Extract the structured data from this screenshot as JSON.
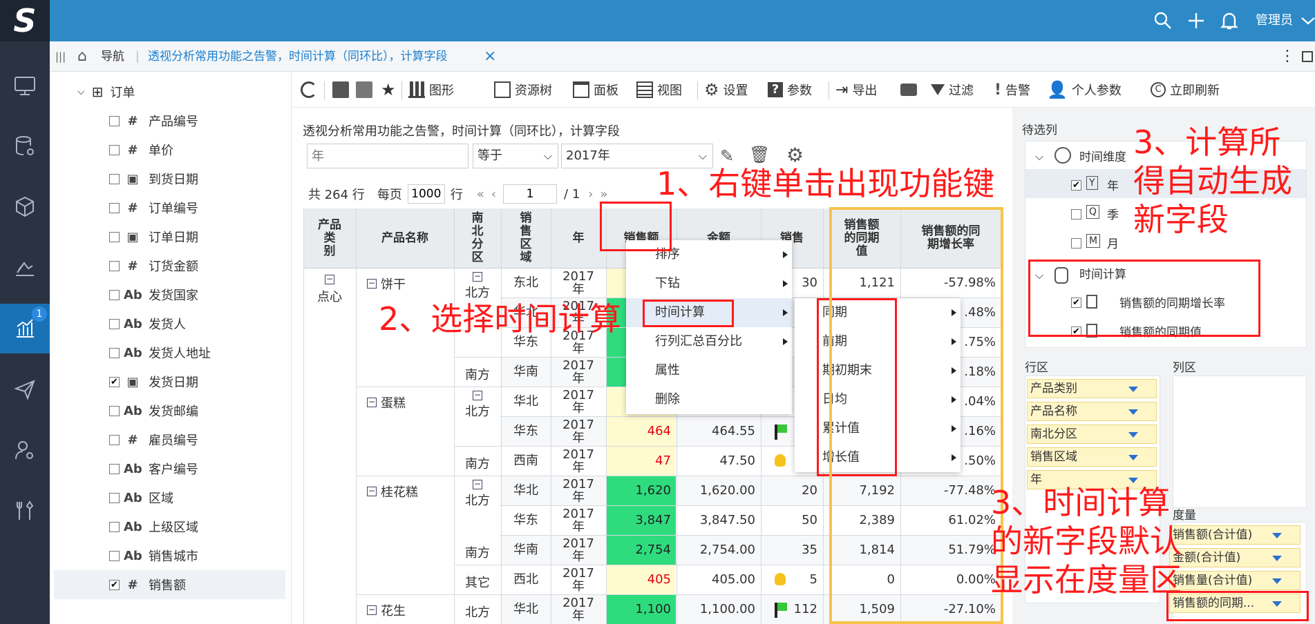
{
  "app": {
    "logo": "S",
    "user": "管理员",
    "nav_badge": "1"
  },
  "tab": {
    "nav_label": "导航",
    "title": "透视分析常用功能之告警，时间计算（同环比），计算字段",
    "close": "×"
  },
  "tree": {
    "root": "订单",
    "fields": [
      {
        "label": "产品编号",
        "type": "#",
        "checked": false
      },
      {
        "label": "单价",
        "type": "#",
        "checked": false
      },
      {
        "label": "到货日期",
        "type": "date",
        "checked": false
      },
      {
        "label": "订单编号",
        "type": "#",
        "checked": false
      },
      {
        "label": "订单日期",
        "type": "date",
        "checked": false
      },
      {
        "label": "订货金额",
        "type": "#",
        "checked": false
      },
      {
        "label": "发货国家",
        "type": "Ab",
        "checked": false
      },
      {
        "label": "发货人",
        "type": "Ab",
        "checked": false
      },
      {
        "label": "发货人地址",
        "type": "Ab",
        "checked": false
      },
      {
        "label": "发货日期",
        "type": "date",
        "checked": true
      },
      {
        "label": "发货邮编",
        "type": "Ab",
        "checked": false
      },
      {
        "label": "雇员编号",
        "type": "#",
        "checked": false
      },
      {
        "label": "客户编号",
        "type": "Ab",
        "checked": false
      },
      {
        "label": "区域",
        "type": "Ab",
        "checked": false
      },
      {
        "label": "上级区域",
        "type": "Ab",
        "checked": false
      },
      {
        "label": "销售城市",
        "type": "Ab",
        "checked": false
      },
      {
        "label": "销售额",
        "type": "#",
        "checked": true
      }
    ]
  },
  "toolbar": {
    "chart": "图形",
    "resource_tree": "资源树",
    "panel": "面板",
    "view": "视图",
    "settings": "设置",
    "params": "参数",
    "export": "导出",
    "filter": "过滤",
    "alert": "告警",
    "personal_params": "个人参数",
    "refresh": "立即刷新"
  },
  "report": {
    "title": "透视分析常用功能之告警，时间计算（同环比），计算字段"
  },
  "filter": {
    "field_placeholder": "年",
    "operator": "等于",
    "value": "2017年"
  },
  "pager": {
    "total": "共 264 行",
    "per_page_label": "每页",
    "per_page": "1000",
    "rows_label": "行",
    "page": "1",
    "total_pages": "/ 1"
  },
  "grid": {
    "headers": [
      "产品类别",
      "产品名称",
      "南北分区",
      "销售区域",
      "年",
      "销售额",
      "金额",
      "销售",
      "销售额的同期值",
      "销售额的同期增长率"
    ],
    "rows": [
      {
        "region": "东北",
        "year": "2017年",
        "sales": "",
        "amount": "",
        "qty": "30",
        "prev": "1,121",
        "growth": "-57.98%"
      },
      {
        "region": "华北",
        "year": "2017年",
        "sales": "",
        "amount": "",
        "qty": "",
        "prev": "",
        "growth": ".48%"
      },
      {
        "region": "华东",
        "year": "2017年",
        "sales": "",
        "amount": "",
        "qty": "",
        "prev": "",
        "growth": ".75%"
      },
      {
        "region": "华南",
        "year": "2017年",
        "sales": "",
        "amount": "",
        "qty": "",
        "prev": "",
        "growth": ".18%"
      },
      {
        "region": "华北",
        "year": "2017年",
        "sales": "",
        "amount": "",
        "qty": "",
        "prev": "",
        "growth": ".04%"
      },
      {
        "region": "华东",
        "year": "2017年",
        "sales": "464",
        "amount": "464.55",
        "qty": "",
        "prev": "",
        "growth": ".16%"
      },
      {
        "region": "西南",
        "year": "2017年",
        "sales": "47",
        "amount": "47.50",
        "qty": "",
        "prev": "",
        "growth": ".50%"
      },
      {
        "region": "华北",
        "year": "2017年",
        "sales": "1,620",
        "amount": "1,620.00",
        "qty": "20",
        "prev": "7,192",
        "growth": "-77.48%"
      },
      {
        "region": "华东",
        "year": "2017年",
        "sales": "3,847",
        "amount": "3,847.50",
        "qty": "50",
        "prev": "2,389",
        "growth": "61.02%"
      },
      {
        "region": "华南",
        "year": "2017年",
        "sales": "2,754",
        "amount": "2,754.00",
        "qty": "35",
        "prev": "1,814",
        "growth": "51.79%"
      },
      {
        "region": "西北",
        "year": "2017年",
        "sales": "405",
        "amount": "405.00",
        "qty": "5",
        "prev": "0",
        "growth": "0.00%"
      },
      {
        "region": "华北",
        "year": "2017年",
        "sales": "1,100",
        "amount": "1,100.00",
        "qty": "112",
        "prev": "1,509",
        "growth": "-27.10%"
      }
    ],
    "categories": [
      {
        "label": "点心"
      }
    ],
    "products": [
      {
        "label": "饼干"
      },
      {
        "label": "蛋糕"
      },
      {
        "label": "桂花糕"
      },
      {
        "label": "花生"
      }
    ],
    "zones": [
      {
        "label": "北方"
      },
      {
        "label": "南方"
      },
      {
        "label": "北方"
      },
      {
        "label": "南方"
      },
      {
        "label": "北方"
      },
      {
        "label": "南方"
      },
      {
        "label": "其它"
      },
      {
        "label": "北方"
      }
    ]
  },
  "context_menu": {
    "items": [
      "排序",
      "下钻",
      "时间计算",
      "行列汇总百分比",
      "属性",
      "删除"
    ],
    "submenu": [
      "同期",
      "前期",
      "期初期末",
      "日均",
      "累计值",
      "增长值"
    ]
  },
  "right_panel": {
    "pending": "待选列",
    "time_dim": "时间维度",
    "year": "年",
    "quarter": "季",
    "month": "月",
    "time_calc": "时间计算",
    "calc_growth": "销售额的同期增长率",
    "calc_prev": "销售额的同期值",
    "row_area": "行区",
    "col_area": "列区",
    "measure_area": "度量",
    "row_fields": [
      "产品类别",
      "产品名称",
      "南北分区",
      "销售区域",
      "年"
    ],
    "measures": [
      "销售额(合计值)",
      "金额(合计值)",
      "销售量(合计值)",
      "销售额的同期..."
    ]
  },
  "annotations": {
    "a1": "1、右键单击出现功能键",
    "a2": "2、选择时间计算",
    "a3": "3、计算所得自动生成新字段",
    "a4": "3、时间计算的新字段默认显示在度量区"
  },
  "colors": {
    "topbar": "#2d8ac6",
    "sidebar": "#2b3342",
    "accent": "#1a72b6",
    "annotation": "#ff1a1a",
    "highlight_box": "#f7c44a",
    "cell_green": "#2edc7e",
    "cell_yellow": "#fefbd0"
  }
}
